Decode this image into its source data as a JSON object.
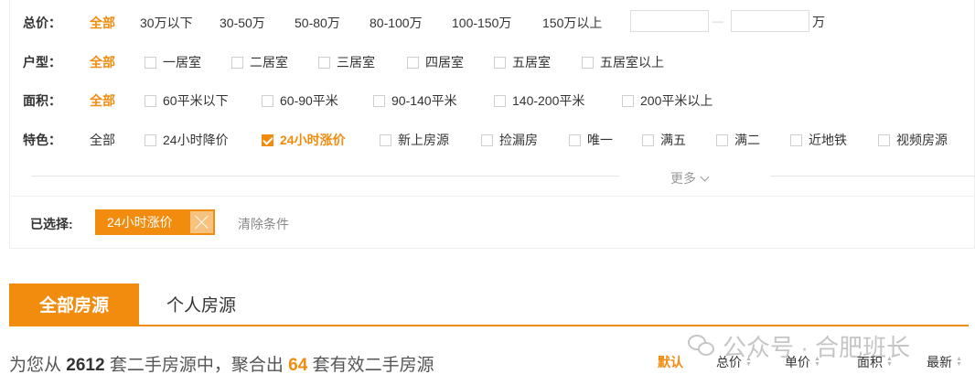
{
  "filters": {
    "price": {
      "label": "总价：",
      "options": [
        "全部",
        "30万以下",
        "30-50万",
        "50-80万",
        "80-100万",
        "100-150万",
        "150万以上"
      ],
      "min_value": "",
      "max_value": "",
      "separator": "—",
      "unit": "万"
    },
    "layout": {
      "label": "户型：",
      "all": "全部",
      "options": [
        "一居室",
        "二居室",
        "三居室",
        "四居室",
        "五居室",
        "五居室以上"
      ]
    },
    "area": {
      "label": "面积：",
      "all": "全部",
      "options": [
        "60平米以下",
        "60-90平米",
        "90-140平米",
        "140-200平米",
        "200平米以上"
      ]
    },
    "feature": {
      "label": "特色：",
      "all": "全部",
      "options": [
        "24小时降价",
        "24小时涨价",
        "新上房源",
        "捡漏房",
        "唯一",
        "满五",
        "满二",
        "近地铁",
        "视频房源"
      ],
      "checked_index": 1
    },
    "more": "更多"
  },
  "selected": {
    "label": "已选择:",
    "tag": "24小时涨价",
    "clear": "清除条件"
  },
  "tabs": {
    "all": "全部房源",
    "personal": "个人房源"
  },
  "summary": {
    "prefix": "为您从",
    "total": "2612",
    "middle": "套二手房源中，聚合出",
    "count": "64",
    "suffix": "套有效二手房源"
  },
  "sort": {
    "default": "默认",
    "total_price": "总价",
    "unit_price": "单价",
    "area": "面积",
    "newest": "最新"
  },
  "watermark": {
    "text": "公众号 · 合肥班长"
  },
  "colors": {
    "accent": "#f28c0f",
    "text": "#333333",
    "muted": "#999999"
  }
}
